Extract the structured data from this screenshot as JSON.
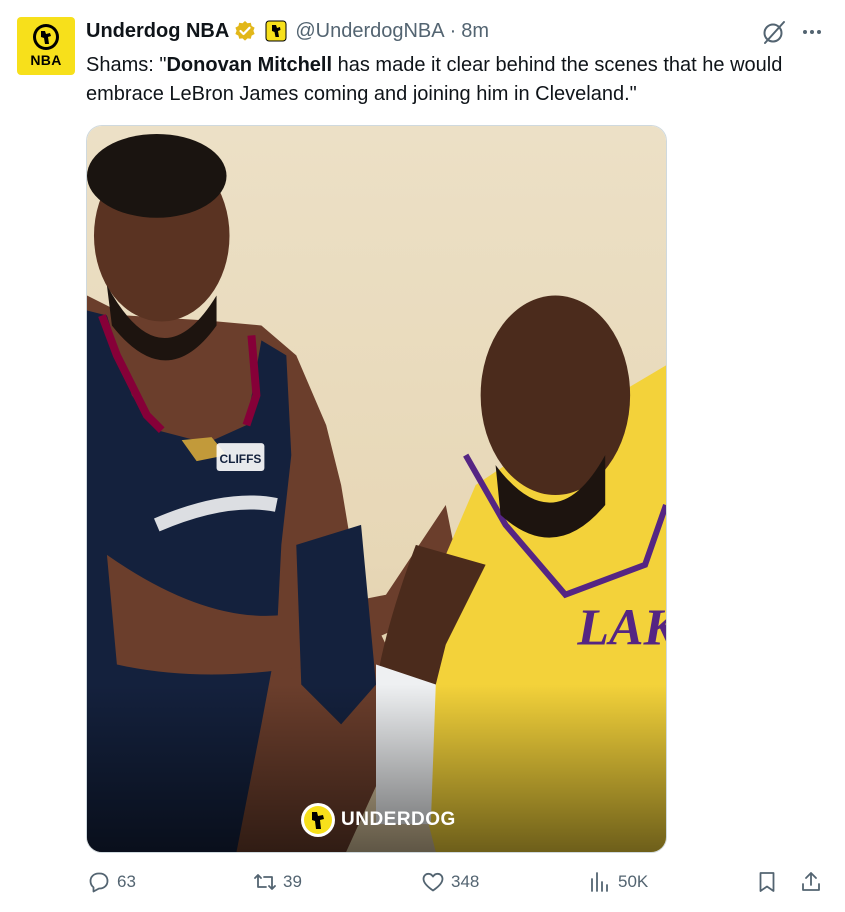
{
  "author": {
    "avatar_text": "NBA",
    "display_name": "Underdog NBA",
    "handle": "@UnderdogNBA",
    "separator": "·",
    "time": "8m",
    "verified_color": "#e2b719"
  },
  "tweet": {
    "text_prefix": "Shams: \"",
    "text_bold": "Donovan Mitchell",
    "text_suffix": " has made it clear behind the scenes that he would embrace LeBron James coming and joining him in Cleveland.\""
  },
  "media": {
    "watermark_text": "UNDERDOG",
    "jersey_left_badge": "CLIFFS",
    "jersey_right_text": "LAKE"
  },
  "metrics": {
    "replies": "63",
    "reposts": "39",
    "likes": "348",
    "views": "50K"
  },
  "colors": {
    "brand_yellow": "#f7e01b",
    "secondary_text": "#536471",
    "primary_text": "#0f1419"
  }
}
